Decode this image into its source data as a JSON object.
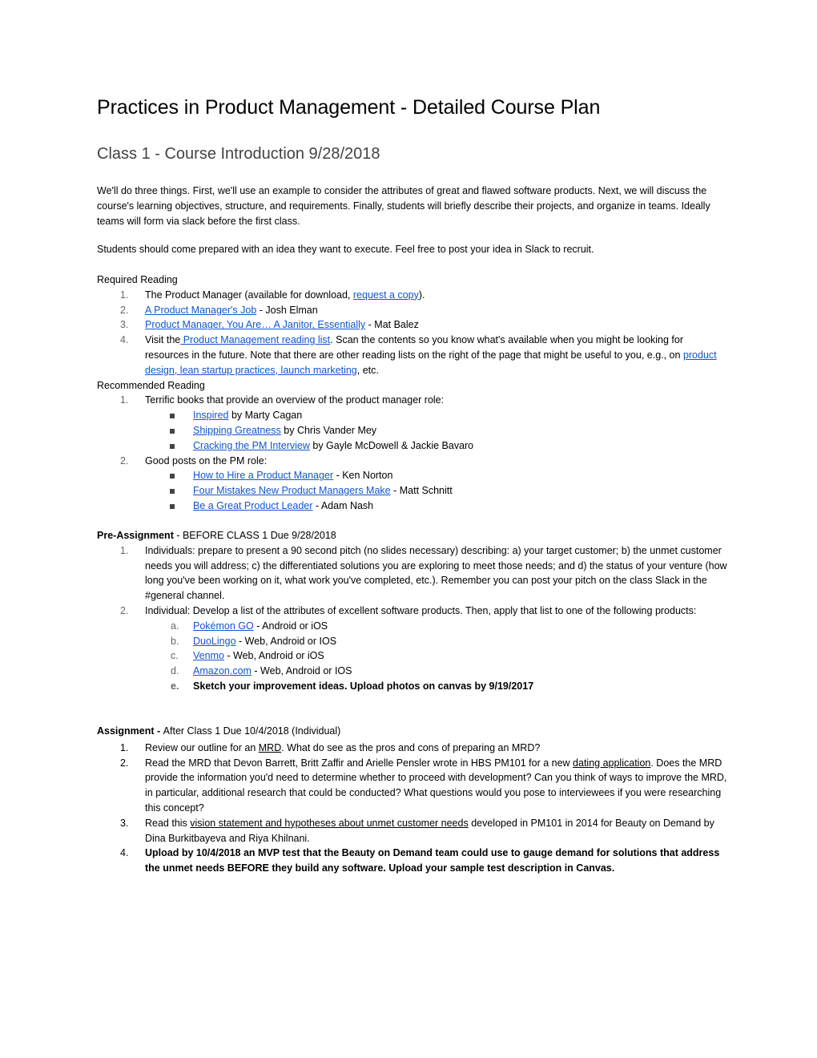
{
  "title": "Practices in Product Management - Detailed Course Plan",
  "class_heading": "Class 1 - Course Introduction 9/28/2018",
  "intro": "We'll do three things. First, we'll use an example to consider the attributes of great and flawed software products. Next, we will discuss the course's learning objectives, structure, and requirements. Finally, students will briefly describe their projects, and organize in teams.  Ideally teams will form via slack before the first class.",
  "prep_note": "Students should come prepared with an idea they want to execute. Feel free to post your idea in Slack to recruit.",
  "required_reading": {
    "heading": "Required Reading",
    "items": [
      {
        "num": "1.",
        "pre": "The Product Manager  (available for download, ",
        "link": " request a copy",
        "post": ")."
      },
      {
        "num": "2.",
        "link": "A Product Manager's Job",
        "post": " - Josh Elman"
      },
      {
        "num": "3.",
        "link": "Product Manager, You Are… A Janitor, Essentially",
        "post": " - Mat Balez"
      },
      {
        "num": "4.",
        "pre": "Visit the",
        "link": " Product Management reading list",
        "post": ". Scan the contents so you know what's available when you might be looking for resources in the future. Note that there are other reading lists on the right of the page that might be useful to you, e.g., on ",
        "links2": [
          "product design",
          ", lean startup practices",
          ", launch marketing"
        ],
        "end": ", etc."
      }
    ]
  },
  "recommended_reading": {
    "heading": "Recommended Reading",
    "groups": [
      {
        "num": "1.",
        "label": "Terrific books that provide an overview of the product manager role:",
        "items": [
          {
            "link": "Inspired",
            "post": " by Marty Cagan"
          },
          {
            "link": "Shipping Greatness",
            "post": " by Chris Vander Mey"
          },
          {
            "link": "Cracking the PM Interview",
            "post": " by Gayle McDowell & Jackie Bavaro"
          }
        ]
      },
      {
        "num": "2.",
        "label": "Good posts on the PM role:",
        "items": [
          {
            "link": "How to Hire a Product Manager",
            "post": " - Ken Norton"
          },
          {
            "link": "Four Mistakes New Product Managers Make",
            "post": " - Matt Schnitt"
          },
          {
            "link": "Be a Great Product Leader",
            "post": " - Adam Nash"
          }
        ]
      }
    ]
  },
  "pre_assignment": {
    "heading_bold": "Pre-Assignment",
    "heading_rest": " - BEFORE CLASS 1 Due 9/28/2018",
    "items": [
      {
        "num": "1.",
        "text": "Individuals: prepare to present  a 90 second pitch (no slides necessary) describing: a) your target customer; b) the unmet customer needs you will address; c) the differentiated solutions you are exploring to meet those needs; and d) the status of your venture (how long you've been working on it, what work you've completed, etc.).  Remember you can post your pitch on the class Slack in the #general channel."
      },
      {
        "num": "2.",
        "text": "Individual: Develop a list of the attributes of excellent software products. Then, apply that list to one of the following products:"
      }
    ],
    "products": [
      {
        "num": "a.",
        "link": "Pokémon GO",
        "post": " - Android or iOS"
      },
      {
        "num": "b.",
        "link": "DuoLingo",
        "post": " - Web, Android or IOS"
      },
      {
        "num": "c.",
        "link": "Venmo",
        "post": " - Web, Android or iOS"
      },
      {
        "num": "d.",
        "link": "Amazon.com",
        "post": " - Web, Android or IOS"
      },
      {
        "num": "e.",
        "bold": "Sketch your improvement ideas. Upload photos on canvas by 9/19/2017"
      }
    ]
  },
  "assignment": {
    "heading_bold": "Assignment - ",
    "heading_rest": "After Class 1 Due 10/4/2018 (Individual)",
    "items": [
      {
        "num": "1.",
        "pre": "Review our outline for an ",
        "link": "MRD",
        "post": ". What do see as the pros and cons of preparing an MRD?"
      },
      {
        "num": "2.",
        "pre": "Read the MRD that Devon Barrett, Britt Zaffir and Arielle Pensler wrote in HBS PM101 for a new ",
        "link": "dating application",
        "post": ". Does the MRD provide the information you'd need to determine whether to proceed with development? Can you think of ways to improve the MRD, in particular, additional research that could be conducted? What questions would you pose to interviewees if you were researching this concept?"
      },
      {
        "num": "3.",
        "pre": "Read this ",
        "link": "vision statement and hypotheses about unmet customer needs",
        "post": " developed in PM101 in 2014 for Beauty on Demand by Dina Burkitbayeva and Riya Khilnani."
      },
      {
        "num": "4.",
        "bold": "Upload by 10/4/2018 an MVP test that the Beauty on Demand team could use to gauge demand for solutions that address the unmet needs BEFORE they build any software. Upload your sample test description in Canvas."
      }
    ]
  }
}
